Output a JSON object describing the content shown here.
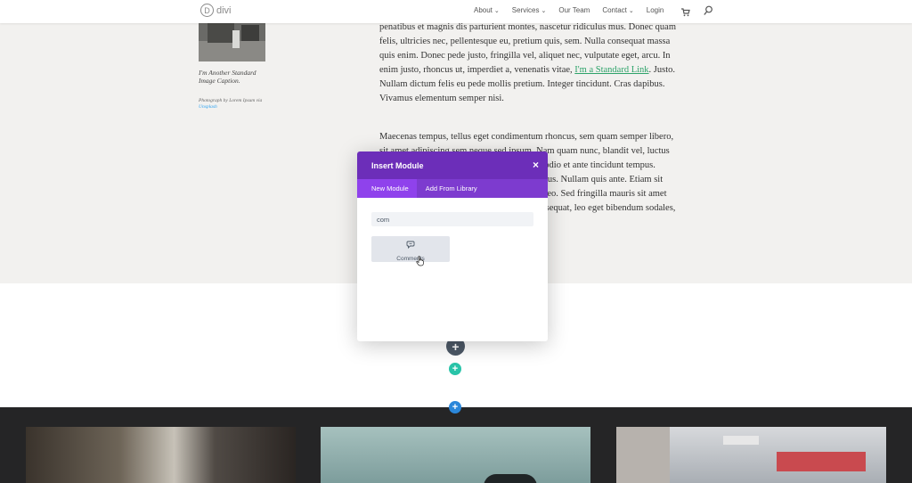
{
  "header": {
    "logo_text": "divi",
    "logo_letter": "D",
    "nav": [
      {
        "label": "About",
        "has_dropdown": true
      },
      {
        "label": "Services",
        "has_dropdown": true
      },
      {
        "label": "Our Team",
        "has_dropdown": false
      },
      {
        "label": "Contact",
        "has_dropdown": true
      },
      {
        "label": "Login",
        "has_dropdown": false
      }
    ],
    "icons": [
      "cart-icon",
      "search-icon"
    ]
  },
  "sidebar_image": {
    "caption": "I'm Another Standard Image Caption.",
    "credit_prefix": "Photograph by Lorem Ipsum via ",
    "credit_link": "Unsplash"
  },
  "article": {
    "p1_before": "penatibus et magnis dis parturient montes, nascetur ridiculus mus. Donec quam felis, ultricies nec, pellentesque eu, pretium quis, sem. Nulla consequat massa quis enim. Donec pede justo, fringilla vel, aliquet nec, vulputate eget, arcu. In enim justo, rhoncus ut, imperdiet a, venenatis vitae, ",
    "p1_link": "I'm a Standard Link",
    "p1_after": ". Justo. Nullam dictum felis eu pede mollis pretium. Integer tincidunt. Cras dapibus. Vivamus elementum semper nisi.",
    "p2": "Maecenas tempus, tellus eget condimentum rhoncus, sem quam semper libero, sit amet adipiscing sem neque sed ipsum. Nam quam nunc, blandit vel, luctus pulvinar, hendrerit id, lorem. Maecenas nec odio et ante tincidunt tempus. Donec vitae sapien ut libero venenatis faucibus. Nullam quis ante. Etiam sit amet orci eget eros faucibus tincidunt. Duis leo. Sed fringilla mauris sit amet nibh. Donec sodales sagittis magna. Sed consequat, leo eget bibendum sodales, augue"
  },
  "modal": {
    "title": "Insert Module",
    "close": "×",
    "tabs": [
      {
        "label": "New Module",
        "active": true
      },
      {
        "label": "Add From Library",
        "active": false
      }
    ],
    "search_value": "com",
    "results": [
      {
        "label": "Comments",
        "icon": "comments-icon"
      }
    ]
  },
  "builder_buttons": {
    "plus": "+"
  },
  "colors": {
    "modal_header": "#6c2eb9",
    "modal_tabs": "#7d3bcf",
    "active_tab": "#8f42ec",
    "green_button": "#29c4a9",
    "blue_button": "#2b87da",
    "dark_button": "#4c5866",
    "link_green": "#2ea36a"
  }
}
